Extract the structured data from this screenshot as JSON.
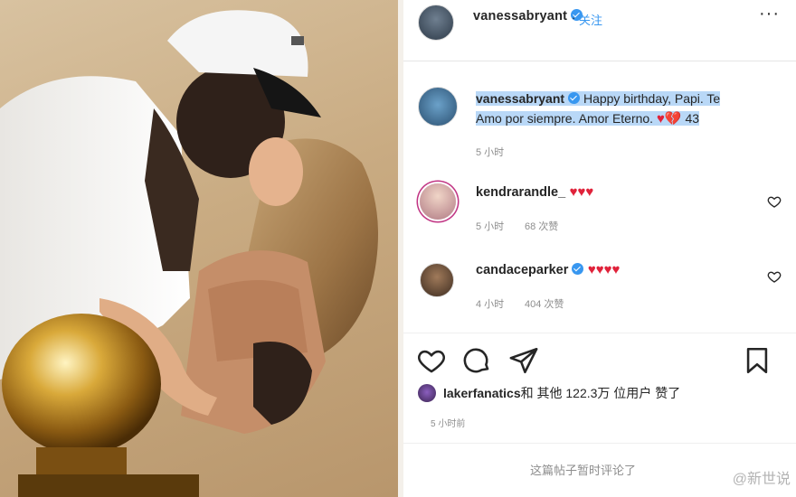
{
  "post": {
    "author": "vanessabryant",
    "follow_label": "关注",
    "dot": "·",
    "more_icon": "more-dots-icon",
    "caption_user": "vanessabryant",
    "caption_line1": "Happy birthday, Papi. Te",
    "caption_line2": "Amo por siempre. Amor Eterno.",
    "caption_emoji": "♥💔",
    "caption_number": "43",
    "caption_time": "5 小时"
  },
  "comments": [
    {
      "user": "kendrarandle_",
      "text": "♥♥♥",
      "time": "5 小时",
      "likes": "68 次赞"
    },
    {
      "user": "candaceparker",
      "text": "♥♥♥♥",
      "time": "4 小时",
      "likes": "404 次赞"
    }
  ],
  "actions": {
    "like_icon": "heart-outline-icon",
    "comment_icon": "comment-bubble-icon",
    "share_icon": "paper-plane-icon",
    "save_icon": "bookmark-icon"
  },
  "likes": {
    "user": "lakerfanatics",
    "text": " 和 其他 122.3万 位用户 赞了"
  },
  "post_time": "5 小时前",
  "add_comment_placeholder": "这篇帖子暂时评论了",
  "watermark": "@新世说",
  "colors": {
    "link_blue": "#3897f0",
    "heart_red": "#e0223a",
    "highlight": "#b9d8f7",
    "muted": "#8e8e8e"
  }
}
